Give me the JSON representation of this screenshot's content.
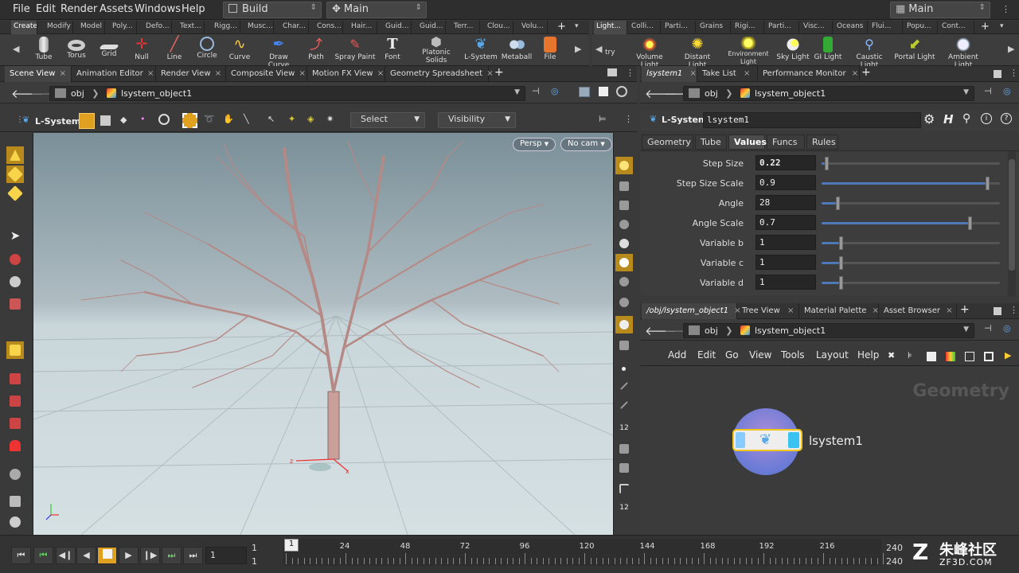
{
  "menubar": {
    "items": [
      "File",
      "Edit",
      "Render",
      "Assets",
      "Windows",
      "Help"
    ],
    "desktop_left": "Build",
    "desktop_main": "Main",
    "desktop_right": "Main"
  },
  "shelf_left": {
    "tabs": [
      "Create",
      "Modify",
      "Model",
      "Poly...",
      "Defo...",
      "Text...",
      "Rigg...",
      "Musc...",
      "Char...",
      "Cons...",
      "Hair...",
      "Guid...",
      "Guid...",
      "Terr...",
      "Clou...",
      "Volu..."
    ],
    "tools": [
      "Tube",
      "Torus",
      "Grid",
      "Null",
      "Line",
      "Circle",
      "Curve",
      "Draw Curve",
      "Path",
      "Spray Paint",
      "Font",
      "Platonic Solids",
      "L-System",
      "Metaball",
      "File"
    ]
  },
  "shelf_right": {
    "tabs": [
      "Light...",
      "Colli...",
      "Parti...",
      "Grains",
      "Rigi...",
      "Parti...",
      "Visc...",
      "Oceans",
      "Flui...",
      "Popu...",
      "Cont..."
    ],
    "partial_tool": "try",
    "tools": [
      "Volume Light",
      "Distant Light",
      "Environment Light",
      "Sky Light",
      "GI Light",
      "Caustic Light",
      "Portal Light",
      "Ambient Light"
    ]
  },
  "viewport_tabs": [
    "Scene View",
    "Animation Editor",
    "Render View",
    "Composite View",
    "Motion FX View",
    "Geometry Spreadsheet"
  ],
  "viewport_path": {
    "root": "obj",
    "node": "lsystem_object1"
  },
  "viewport_toolbar": {
    "state": "L-System",
    "select": "Select",
    "visibility": "Visibility"
  },
  "viewport": {
    "persp": "Persp",
    "cam": "No cam"
  },
  "params_tabs": [
    "lsystem1",
    "Take List",
    "Performance Monitor"
  ],
  "params_path": {
    "root": "obj",
    "node": "lsystem_object1"
  },
  "params_header": {
    "type": "L-System",
    "name": "lsystem1"
  },
  "params_subtabs": [
    "Geometry",
    "Tube",
    "Values",
    "Funcs",
    "Rules"
  ],
  "params": [
    {
      "label": "Step Size",
      "value": "0.22",
      "level": 0.02
    },
    {
      "label": "Step Size Scale",
      "value": "0.9",
      "level": 0.94
    },
    {
      "label": "Angle",
      "value": "28",
      "level": 0.08
    },
    {
      "label": "Angle Scale",
      "value": "0.7",
      "level": 0.84
    },
    {
      "label": "Variable b",
      "value": "1",
      "level": 0.1
    },
    {
      "label": "Variable c",
      "value": "1",
      "level": 0.1
    },
    {
      "label": "Variable d",
      "value": "1",
      "level": 0.1
    }
  ],
  "network_tabs": [
    "/obj/lsystem_object1",
    "Tree View",
    "Material Palette",
    "Asset Browser"
  ],
  "network_path": {
    "root": "obj",
    "node": "lsystem_object1"
  },
  "network_menu": [
    "Add",
    "Edit",
    "Go",
    "View",
    "Tools",
    "Layout",
    "Help"
  ],
  "network": {
    "context_label": "Geometry",
    "node_name": "lsystem1"
  },
  "timeline": {
    "current_frame": "1",
    "start_a": "1",
    "start_b": "1",
    "frame_marker": "1",
    "ticks": [
      "24",
      "48",
      "72",
      "96",
      "120",
      "144",
      "168",
      "192",
      "216"
    ],
    "end_a": "240",
    "end_b": "240"
  },
  "watermark": {
    "brand": "朱峰社区",
    "url": "ZF3D.COM"
  },
  "colors": {
    "accent_blue": "#4e78b8",
    "tree_branch": "#b58a86",
    "sky_top": "#7a8f98",
    "ground": "#c9d6da"
  }
}
